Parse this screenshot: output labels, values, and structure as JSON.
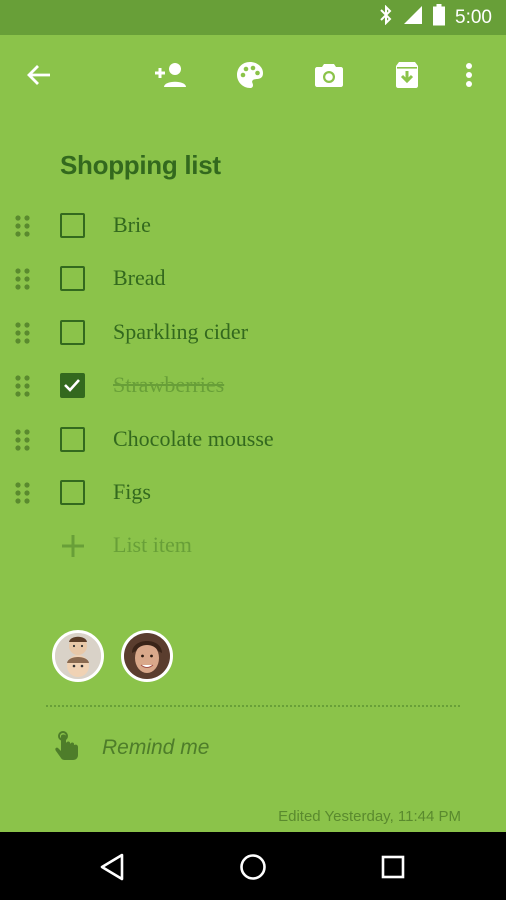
{
  "status": {
    "time": "5:00",
    "icons": [
      "bluetooth-icon",
      "signal-icon",
      "battery-icon"
    ]
  },
  "toolbar": {
    "actions": [
      "back-arrow-icon",
      "add-collaborator-icon",
      "palette-icon",
      "camera-icon",
      "archive-icon",
      "more-vert-icon"
    ]
  },
  "note": {
    "title": "Shopping list",
    "items": [
      {
        "label": "Brie",
        "checked": false
      },
      {
        "label": "Bread",
        "checked": false
      },
      {
        "label": "Sparkling cider",
        "checked": false
      },
      {
        "label": "Strawberries",
        "checked": true
      },
      {
        "label": "Chocolate mousse",
        "checked": false
      },
      {
        "label": "Figs",
        "checked": false
      }
    ],
    "add_placeholder": "List item",
    "remind_label": "Remind me",
    "edited": "Edited Yesterday, 11:44 PM"
  },
  "colors": {
    "background": "#8bc34a",
    "statusbar": "#689f38",
    "text": "#33691e"
  }
}
